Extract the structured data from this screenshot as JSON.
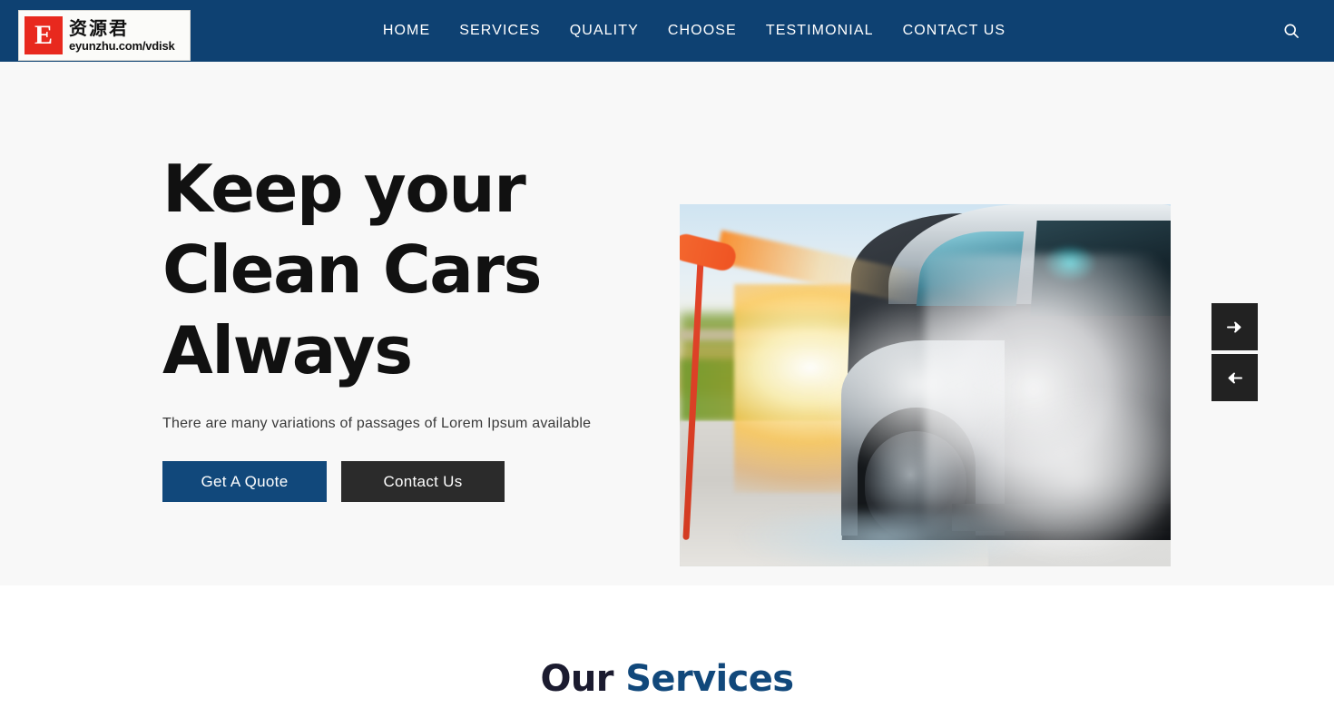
{
  "theme": {
    "header_bg": "#0E4172",
    "accent_blue": "#11487B",
    "dark_button": "#2b2b2b",
    "hero_bg": "#f8f8f8",
    "heading_dark": "#1B1B2F",
    "logo_red": "#e8291e"
  },
  "logo": {
    "name": "eyunzhu-logo-watermark",
    "mark_letter": "E",
    "chinese_text": "资源君",
    "url_text": "eyunzhu.com/vdisk"
  },
  "nav": {
    "items": [
      {
        "label": "HOME",
        "name": "nav-item-home"
      },
      {
        "label": "SERVICES",
        "name": "nav-item-services"
      },
      {
        "label": "QUALITY",
        "name": "nav-item-quality"
      },
      {
        "label": "CHOOSE",
        "name": "nav-item-choose"
      },
      {
        "label": "TESTIMONIAL",
        "name": "nav-item-testimonial"
      },
      {
        "label": "CONTACT US",
        "name": "nav-item-contact-us"
      }
    ],
    "search_icon": "search-icon"
  },
  "hero": {
    "title_line1": "Keep your",
    "title_line2": "Clean Cars",
    "title_line3": "Always",
    "subtitle": "There are many variations of passages of Lorem Ipsum available",
    "primary_button": "Get A Quote",
    "secondary_button": "Contact Us",
    "image_alt": "Car being pressure washed at sunset",
    "slider": {
      "next_icon": "arrow-right-icon",
      "prev_icon": "arrow-left-icon",
      "next_glyph": "➜",
      "prev_glyph": "➜"
    }
  },
  "services": {
    "title_prefix": "Our ",
    "title_accent": "Services"
  }
}
